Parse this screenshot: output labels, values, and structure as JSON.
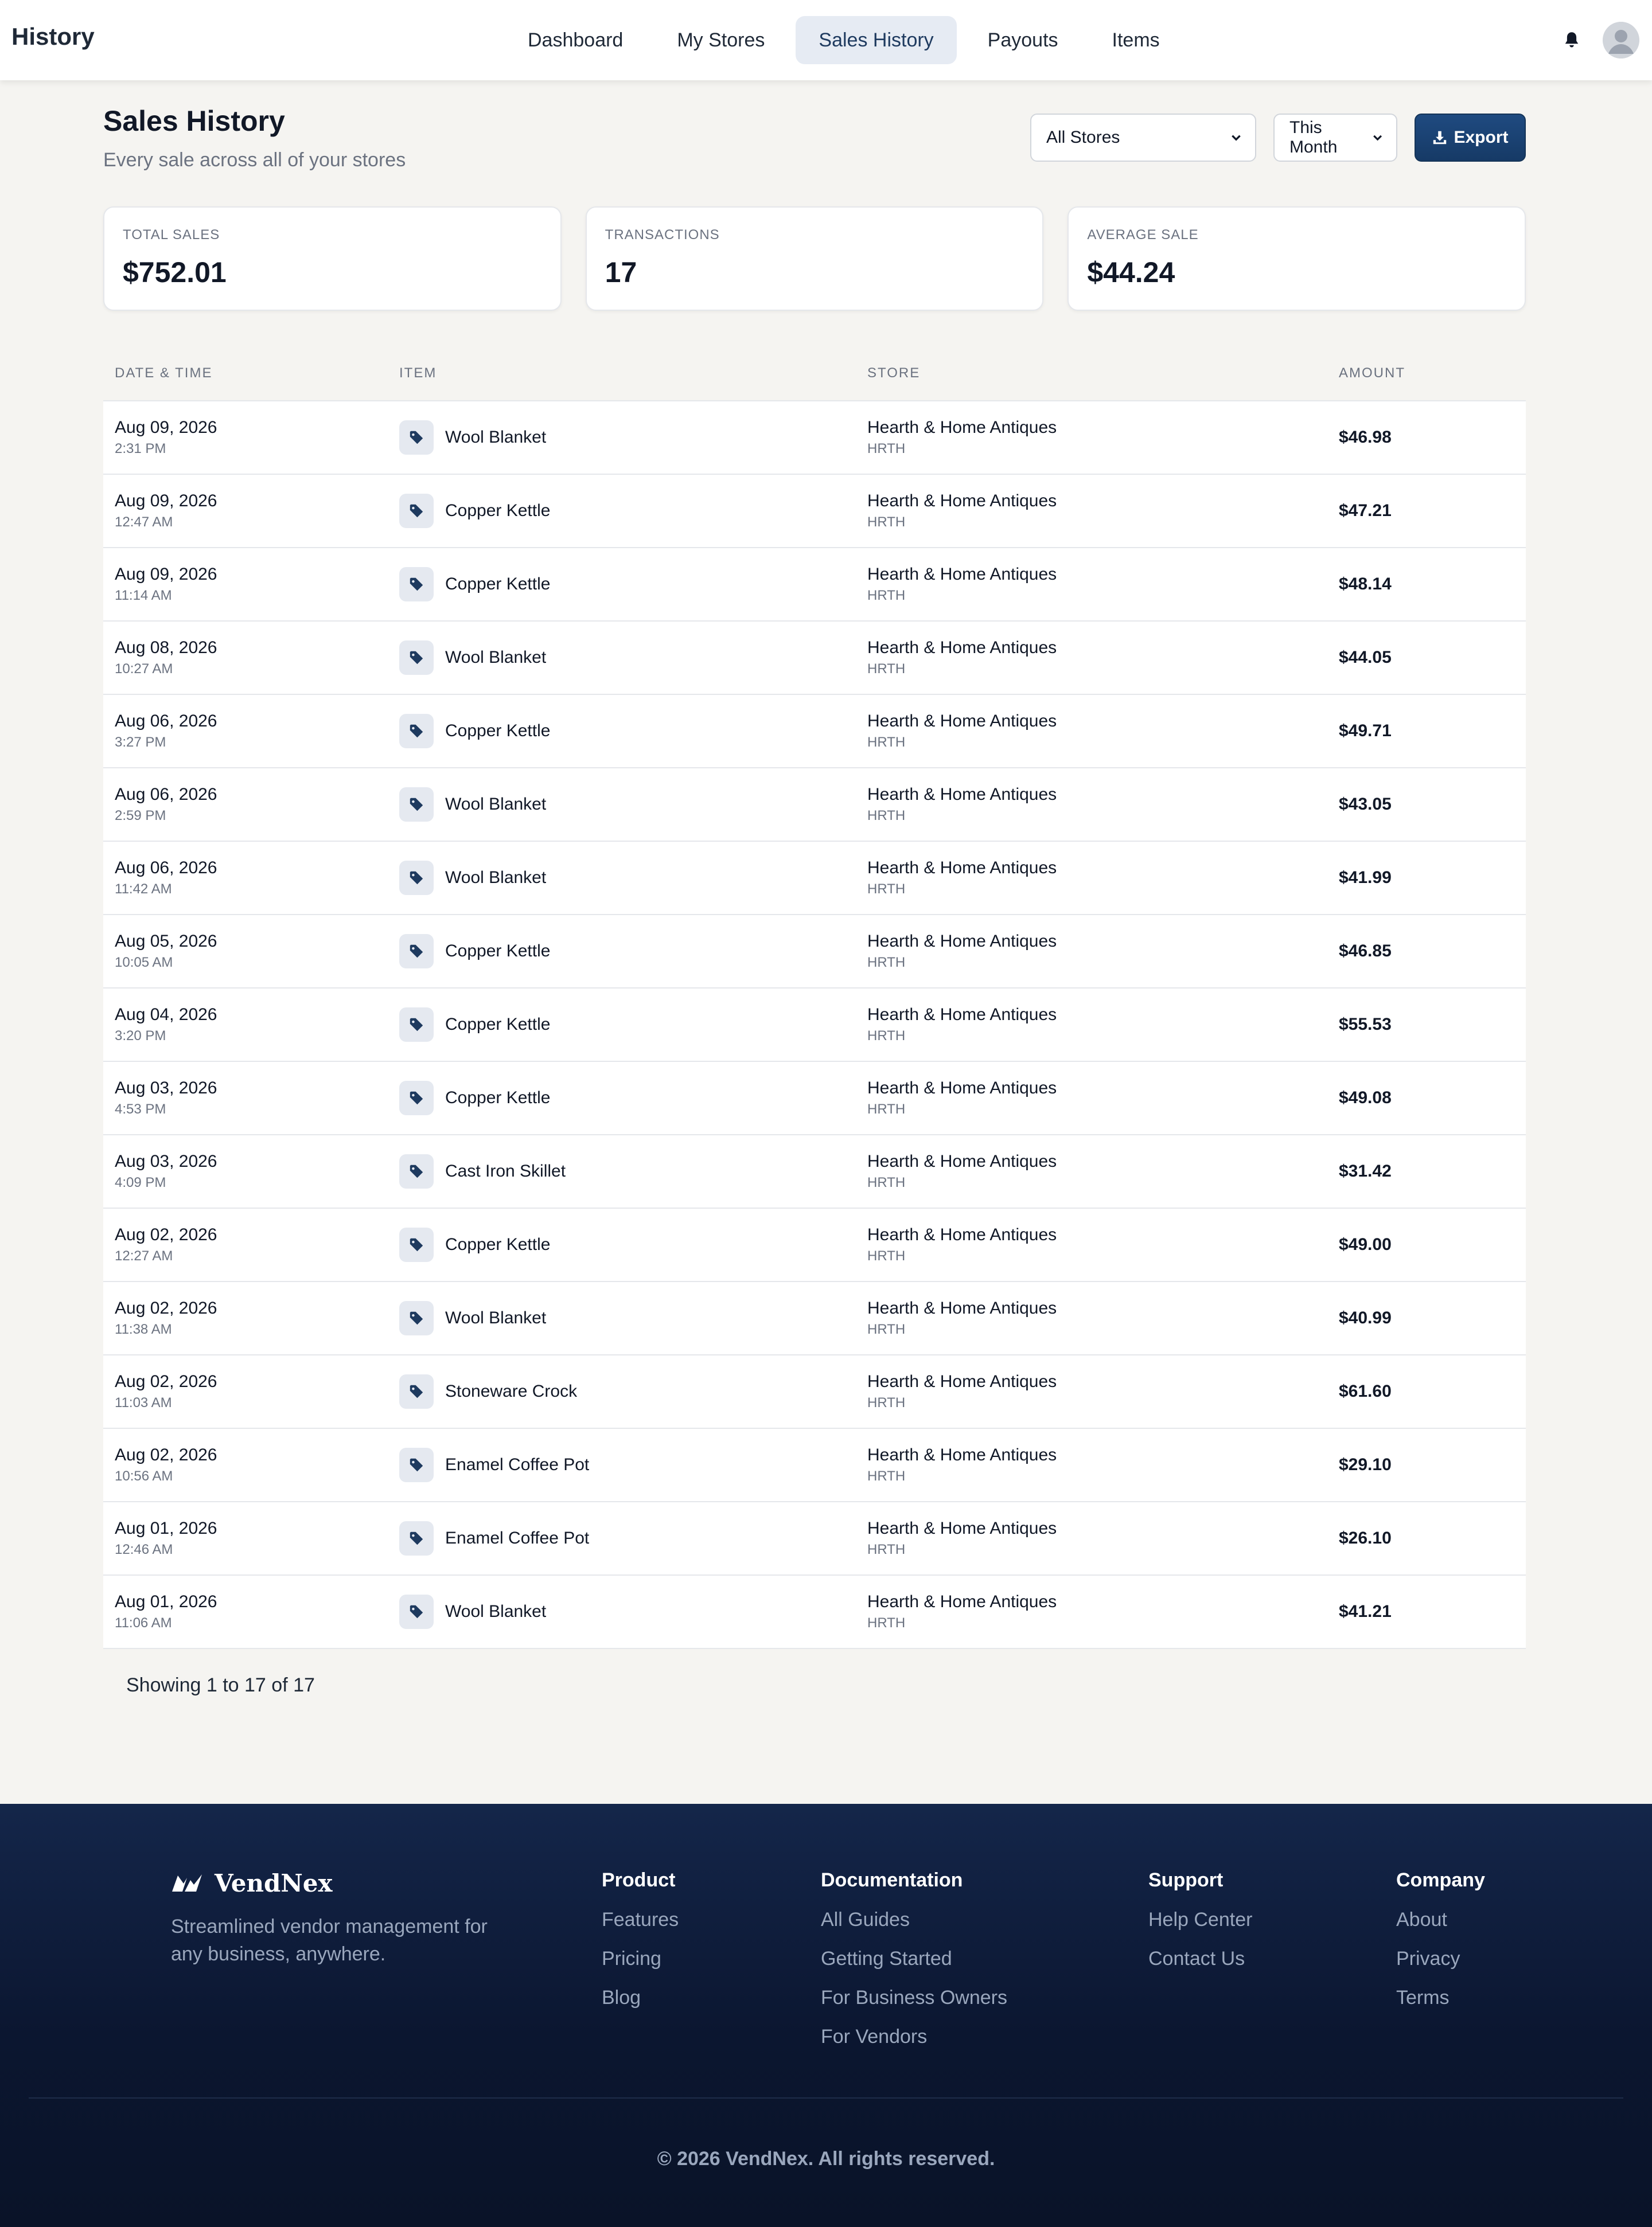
{
  "nav": {
    "title": "History",
    "links": [
      "Dashboard",
      "My Stores",
      "Sales History",
      "Payouts",
      "Items"
    ],
    "active": "Sales History"
  },
  "header": {
    "title": "Sales History",
    "subtitle": "Every sale across all of your stores",
    "store_filter": "All Stores",
    "period_filter": "This Month",
    "export_label": "Export"
  },
  "stats": [
    {
      "label": "TOTAL SALES",
      "value": "$752.01"
    },
    {
      "label": "TRANSACTIONS",
      "value": "17"
    },
    {
      "label": "AVERAGE SALE",
      "value": "$44.24"
    }
  ],
  "table": {
    "columns": [
      "DATE & TIME",
      "ITEM",
      "STORE",
      "AMOUNT"
    ],
    "rows": [
      {
        "date": "Aug 09, 2026",
        "time": "2:31 PM",
        "item": "Wool Blanket",
        "store": "Hearth & Home Antiques",
        "code": "HRTH",
        "amount": "$46.98"
      },
      {
        "date": "Aug 09, 2026",
        "time": "12:47 AM",
        "item": "Copper Kettle",
        "store": "Hearth & Home Antiques",
        "code": "HRTH",
        "amount": "$47.21"
      },
      {
        "date": "Aug 09, 2026",
        "time": "11:14 AM",
        "item": "Copper Kettle",
        "store": "Hearth & Home Antiques",
        "code": "HRTH",
        "amount": "$48.14"
      },
      {
        "date": "Aug 08, 2026",
        "time": "10:27 AM",
        "item": "Wool Blanket",
        "store": "Hearth & Home Antiques",
        "code": "HRTH",
        "amount": "$44.05"
      },
      {
        "date": "Aug 06, 2026",
        "time": "3:27 PM",
        "item": "Copper Kettle",
        "store": "Hearth & Home Antiques",
        "code": "HRTH",
        "amount": "$49.71"
      },
      {
        "date": "Aug 06, 2026",
        "time": "2:59 PM",
        "item": "Wool Blanket",
        "store": "Hearth & Home Antiques",
        "code": "HRTH",
        "amount": "$43.05"
      },
      {
        "date": "Aug 06, 2026",
        "time": "11:42 AM",
        "item": "Wool Blanket",
        "store": "Hearth & Home Antiques",
        "code": "HRTH",
        "amount": "$41.99"
      },
      {
        "date": "Aug 05, 2026",
        "time": "10:05 AM",
        "item": "Copper Kettle",
        "store": "Hearth & Home Antiques",
        "code": "HRTH",
        "amount": "$46.85"
      },
      {
        "date": "Aug 04, 2026",
        "time": "3:20 PM",
        "item": "Copper Kettle",
        "store": "Hearth & Home Antiques",
        "code": "HRTH",
        "amount": "$55.53"
      },
      {
        "date": "Aug 03, 2026",
        "time": "4:53 PM",
        "item": "Copper Kettle",
        "store": "Hearth & Home Antiques",
        "code": "HRTH",
        "amount": "$49.08"
      },
      {
        "date": "Aug 03, 2026",
        "time": "4:09 PM",
        "item": "Cast Iron Skillet",
        "store": "Hearth & Home Antiques",
        "code": "HRTH",
        "amount": "$31.42"
      },
      {
        "date": "Aug 02, 2026",
        "time": "12:27 AM",
        "item": "Copper Kettle",
        "store": "Hearth & Home Antiques",
        "code": "HRTH",
        "amount": "$49.00"
      },
      {
        "date": "Aug 02, 2026",
        "time": "11:38 AM",
        "item": "Wool Blanket",
        "store": "Hearth & Home Antiques",
        "code": "HRTH",
        "amount": "$40.99"
      },
      {
        "date": "Aug 02, 2026",
        "time": "11:03 AM",
        "item": "Stoneware Crock",
        "store": "Hearth & Home Antiques",
        "code": "HRTH",
        "amount": "$61.60"
      },
      {
        "date": "Aug 02, 2026",
        "time": "10:56 AM",
        "item": "Enamel Coffee Pot",
        "store": "Hearth & Home Antiques",
        "code": "HRTH",
        "amount": "$29.10"
      },
      {
        "date": "Aug 01, 2026",
        "time": "12:46 AM",
        "item": "Enamel Coffee Pot",
        "store": "Hearth & Home Antiques",
        "code": "HRTH",
        "amount": "$26.10"
      },
      {
        "date": "Aug 01, 2026",
        "time": "11:06 AM",
        "item": "Wool Blanket",
        "store": "Hearth & Home Antiques",
        "code": "HRTH",
        "amount": "$41.21"
      }
    ],
    "showing": "Showing 1 to 17 of 17"
  },
  "footer": {
    "brand": "VendNex",
    "tagline": "Streamlined vendor management for any business, anywhere.",
    "columns": [
      {
        "title": "Product",
        "links": [
          "Features",
          "Pricing",
          "Blog"
        ]
      },
      {
        "title": "Documentation",
        "links": [
          "All Guides",
          "Getting Started",
          "For Business Owners",
          "For Vendors"
        ]
      },
      {
        "title": "Support",
        "links": [
          "Help Center",
          "Contact Us"
        ]
      },
      {
        "title": "Company",
        "links": [
          "About",
          "Privacy",
          "Terms"
        ]
      }
    ],
    "copyright": "© 2026 VendNex. All rights reserved."
  },
  "icons": {
    "bell": "bell-icon",
    "avatar": "user-avatar-icon",
    "export": "download-icon",
    "item": "tag-icon",
    "chevron": "chevron-down-icon",
    "logo": "vendnex-logo-icon"
  },
  "colors": {
    "accent": "#1f4a80",
    "active_nav_bg": "#e6ebf3",
    "footer_bg": "#0b1630"
  }
}
